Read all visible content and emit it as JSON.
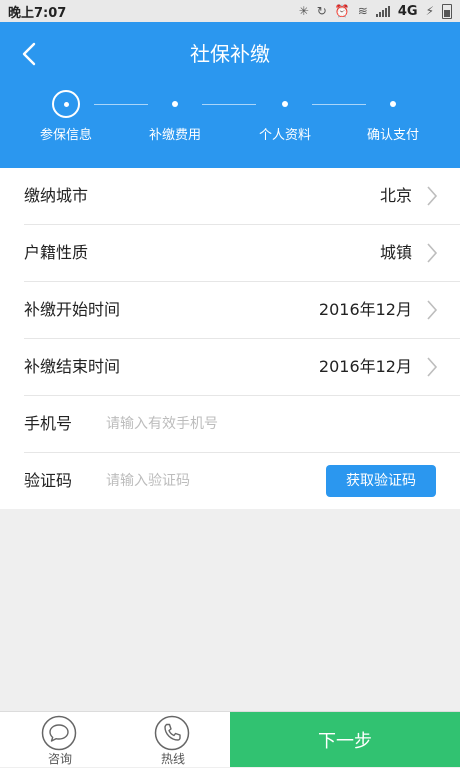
{
  "status_bar": {
    "time": "晚上7:07",
    "network": "4G"
  },
  "header": {
    "title": "社保补缴",
    "back_icon": "chevron-left-icon",
    "steps": [
      {
        "label": "参保信息",
        "active": true
      },
      {
        "label": "补缴费用",
        "active": false
      },
      {
        "label": "个人资料",
        "active": false
      },
      {
        "label": "确认支付",
        "active": false
      }
    ]
  },
  "form": {
    "city": {
      "label": "缴纳城市",
      "value": "北京"
    },
    "household": {
      "label": "户籍性质",
      "value": "城镇"
    },
    "start_time": {
      "label": "补缴开始时间",
      "value": "2016年12月"
    },
    "end_time": {
      "label": "补缴结束时间",
      "value": "2016年12月"
    },
    "phone": {
      "label": "手机号",
      "value": "",
      "placeholder": "请输入有效手机号"
    },
    "code": {
      "label": "验证码",
      "value": "",
      "placeholder": "请输入验证码",
      "button_label": "获取验证码"
    }
  },
  "bottom_bar": {
    "consult_label": "咨询",
    "hotline_label": "热线",
    "next_label": "下一步"
  },
  "colors": {
    "primary": "#2b97ef",
    "next_button": "#31c271",
    "placeholder": "#bcbcbc"
  }
}
